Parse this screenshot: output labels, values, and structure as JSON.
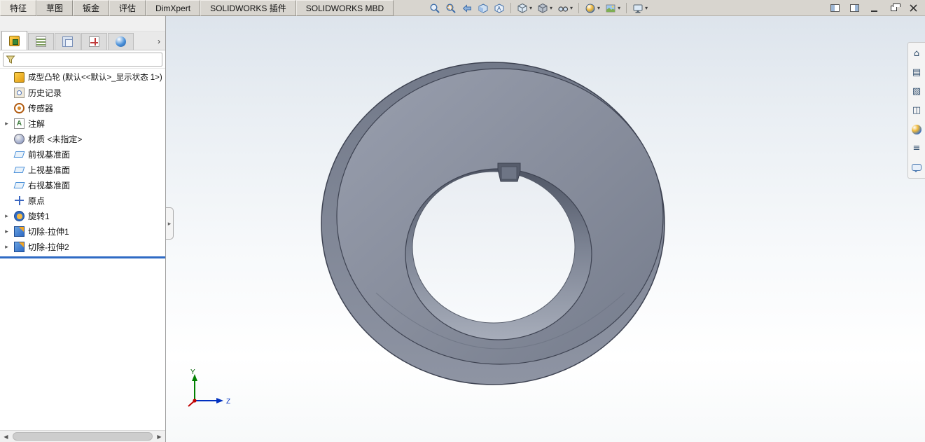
{
  "ribbon": {
    "tabs": [
      {
        "label": "特征"
      },
      {
        "label": "草图"
      },
      {
        "label": "钣金"
      },
      {
        "label": "评估"
      },
      {
        "label": "DimXpert"
      },
      {
        "label": "SOLIDWORKS 插件"
      },
      {
        "label": "SOLIDWORKS MBD"
      }
    ],
    "toolbar_icons": [
      "zoom-fit",
      "zoom-to-area",
      "previous-view",
      "section-view",
      "dynamic-annotation-views",
      "view-orientation",
      "display-style",
      "hide-show-items",
      "edit-appearance",
      "apply-scene",
      "view-settings"
    ]
  },
  "window_controls": [
    "toggle-left-pane",
    "toggle-right-pane",
    "minimize",
    "restore",
    "close"
  ],
  "feature_panel": {
    "tabs": [
      "featuremanager-design-tree",
      "propertymanager",
      "configurationmanager",
      "dimxpertmanager",
      "displaymanager"
    ],
    "filter": {
      "value": "",
      "placeholder": ""
    },
    "tree": {
      "root_label": "成型凸轮 (默认<<默认>_显示状态 1>)",
      "items": [
        {
          "label": "历史记录",
          "icon": "history-folder",
          "arrow": ""
        },
        {
          "label": "传感器",
          "icon": "sensors",
          "arrow": ""
        },
        {
          "label": "注解",
          "icon": "annotations",
          "arrow": "▸"
        },
        {
          "label": "材质 <未指定>",
          "icon": "material",
          "arrow": ""
        },
        {
          "label": "前视基准面",
          "icon": "plane",
          "arrow": ""
        },
        {
          "label": "上视基准面",
          "icon": "plane",
          "arrow": ""
        },
        {
          "label": "右视基准面",
          "icon": "plane",
          "arrow": ""
        },
        {
          "label": "原点",
          "icon": "origin",
          "arrow": ""
        },
        {
          "label": "旋转1",
          "icon": "revolve",
          "arrow": "▸"
        },
        {
          "label": "切除-拉伸1",
          "icon": "cut-extrude",
          "arrow": "▸"
        },
        {
          "label": "切除-拉伸2",
          "icon": "cut-extrude",
          "arrow": "▸"
        }
      ]
    }
  },
  "task_pane": {
    "icons": [
      "solidworks-resources-home",
      "design-library",
      "file-explorer",
      "view-palette",
      "appearances-scenes",
      "custom-properties",
      "solidworks-forum"
    ]
  },
  "viewport": {
    "triad": {
      "y_label": "Y",
      "z_label": "Z"
    }
  },
  "icons": {
    "caret": "▾",
    "chevron_right": "›",
    "arrow_left": "◀",
    "arrow_right": "▶",
    "panel_flyout": "▸",
    "home": "⌂",
    "design_library": "▤",
    "file_explorer": "▧",
    "view_palette": "◫",
    "custom_properties": "≡"
  },
  "colors": {
    "rollback_bar": "#2f6bc4",
    "model_base": "#8a90a0",
    "viewport_gradient_top": "#dde4ec",
    "axis_y": "#008000",
    "axis_z": "#0030c0",
    "axis_x": "#c00000"
  }
}
